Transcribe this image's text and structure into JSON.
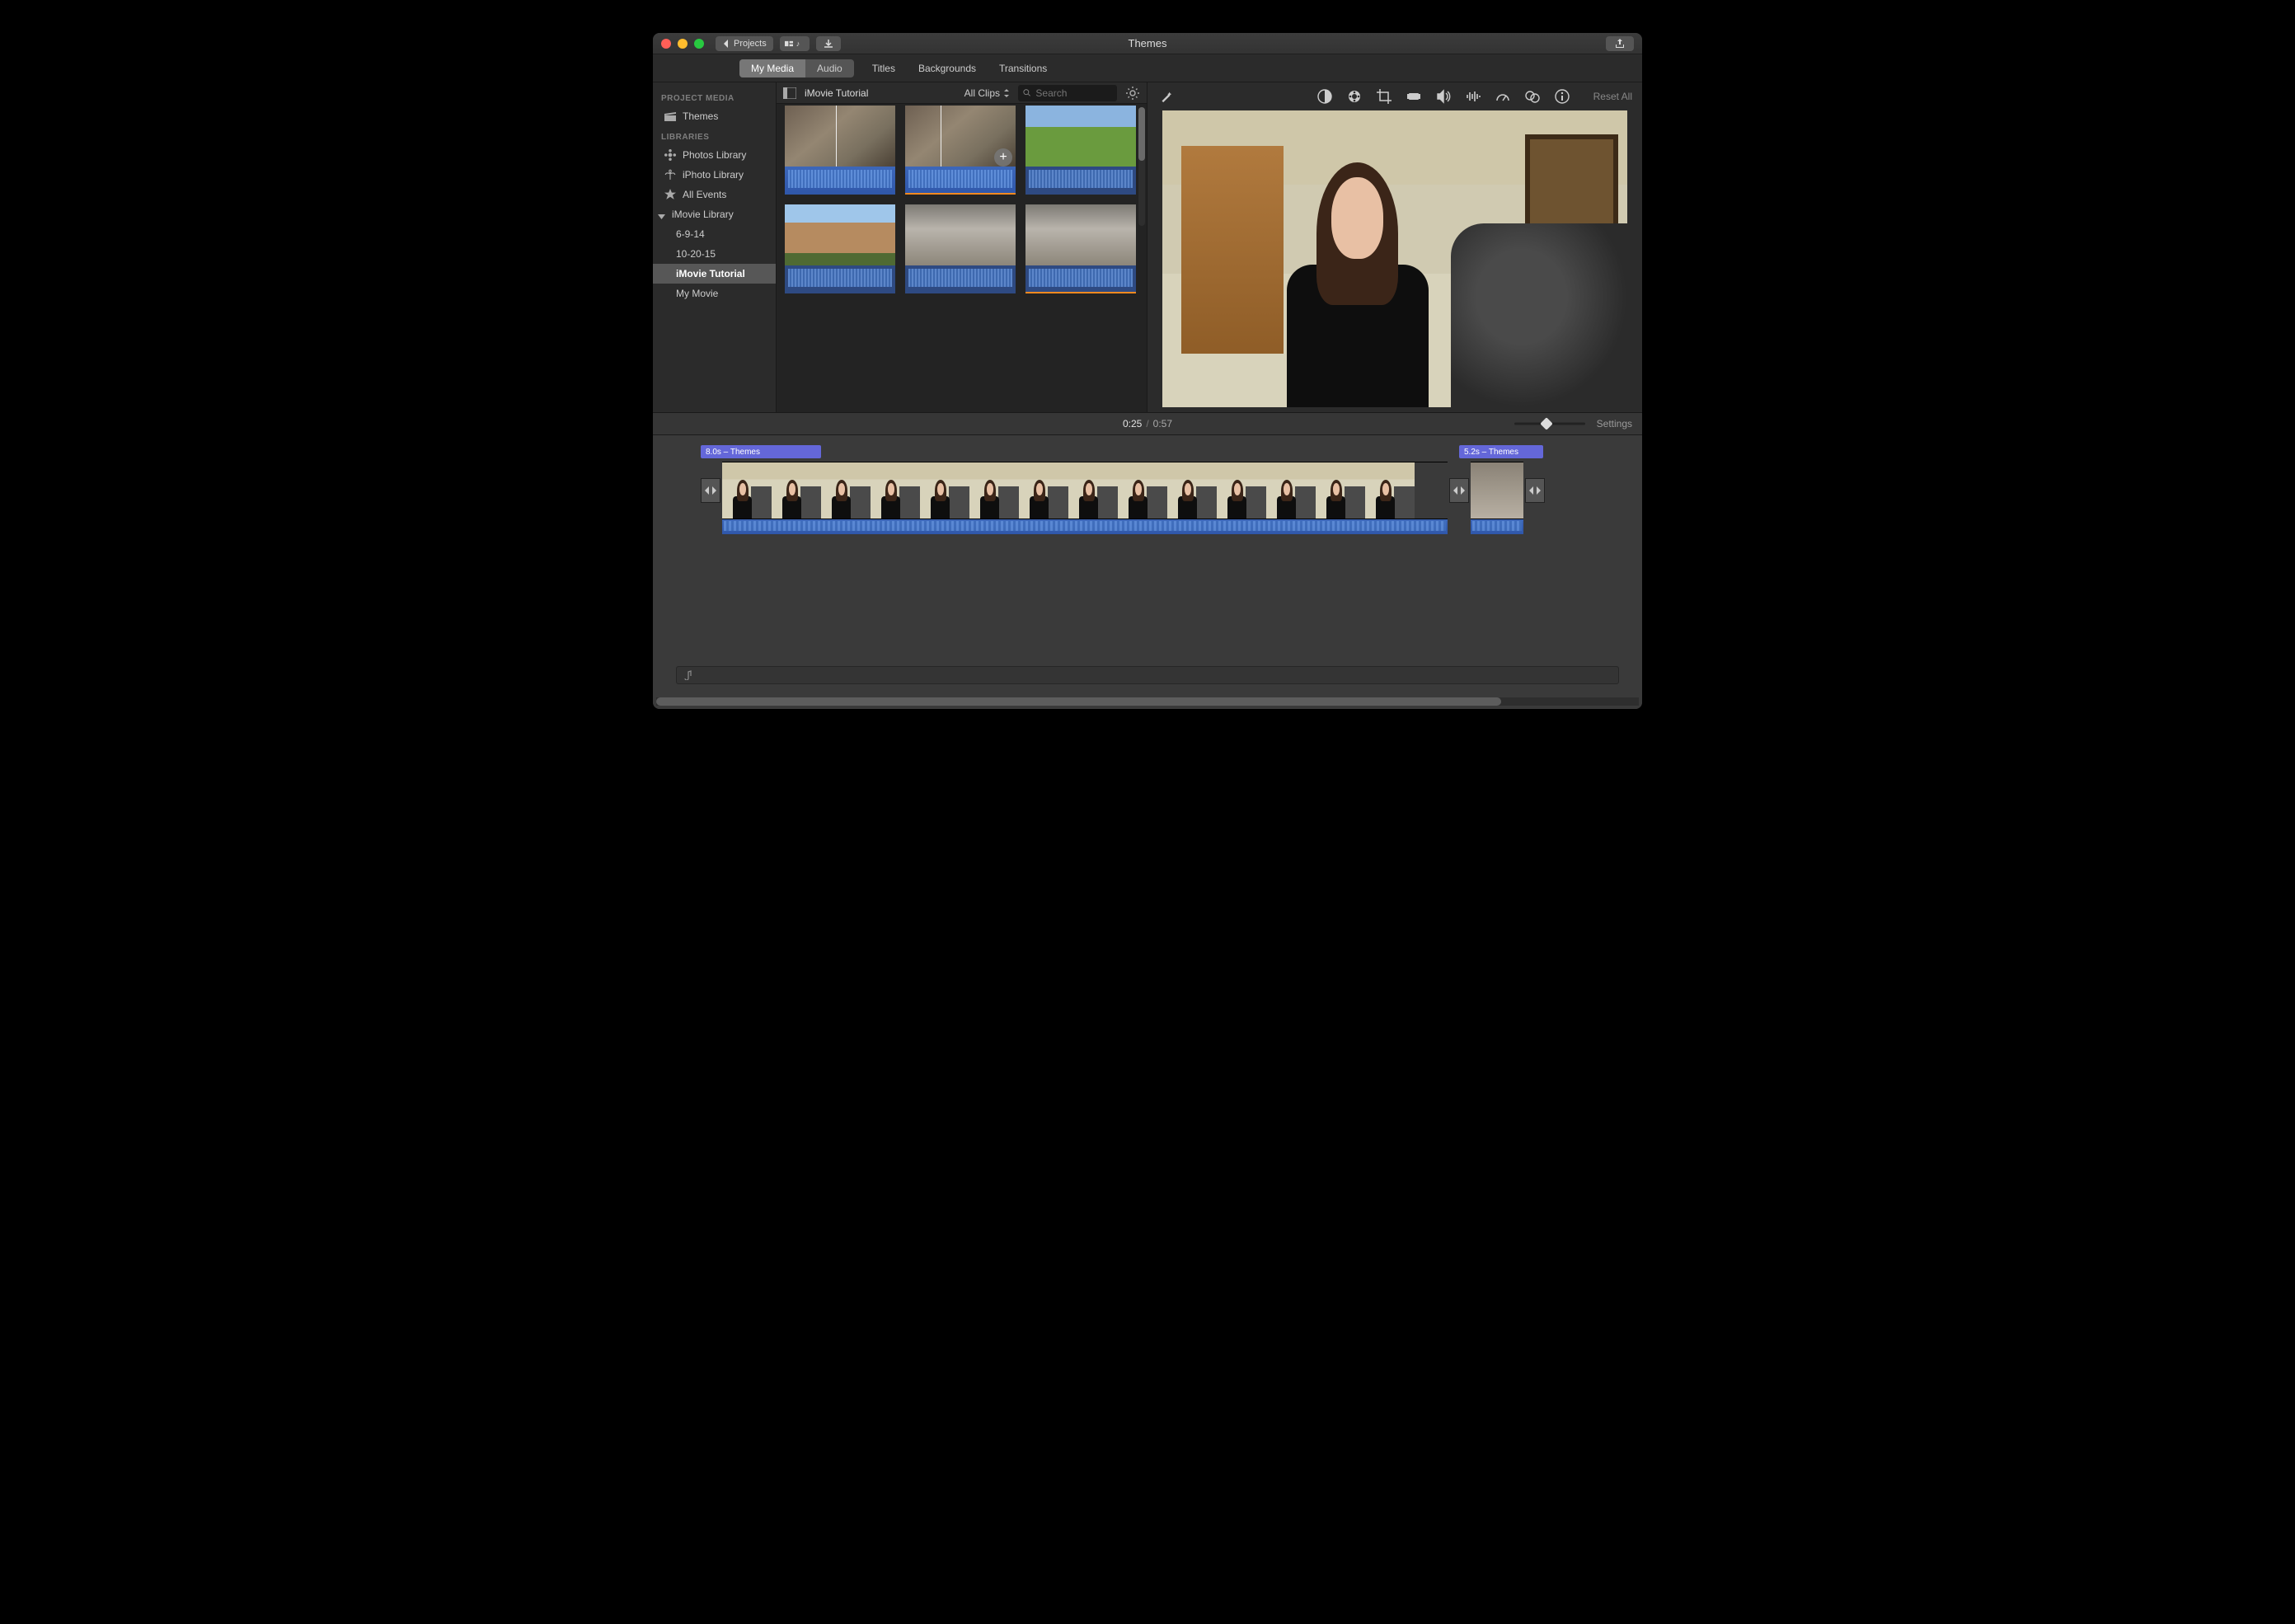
{
  "titlebar": {
    "title": "Themes",
    "back_label": "Projects"
  },
  "tabs": {
    "segmented": [
      "My Media",
      "Audio"
    ],
    "active_index": 0,
    "free": [
      "Titles",
      "Backgrounds",
      "Transitions"
    ]
  },
  "sidebar": {
    "section1": "PROJECT MEDIA",
    "themes": "Themes",
    "section2": "LIBRARIES",
    "photos": "Photos Library",
    "iphoto": "iPhoto Library",
    "allevents": "All Events",
    "imovie_lib": "iMovie Library",
    "children": [
      "6-9-14",
      "10-20-15",
      "iMovie Tutorial",
      "My Movie"
    ],
    "selected_child_index": 2
  },
  "browser": {
    "title": "iMovie Tutorial",
    "filter": "All Clips",
    "search_placeholder": "Search"
  },
  "midbar": {
    "current": "0:25",
    "total": "0:57",
    "settings": "Settings"
  },
  "viewer": {
    "reset": "Reset All"
  },
  "timeline": {
    "label_a": "8.0s – Themes",
    "label_b": "5.2s – Themes"
  }
}
